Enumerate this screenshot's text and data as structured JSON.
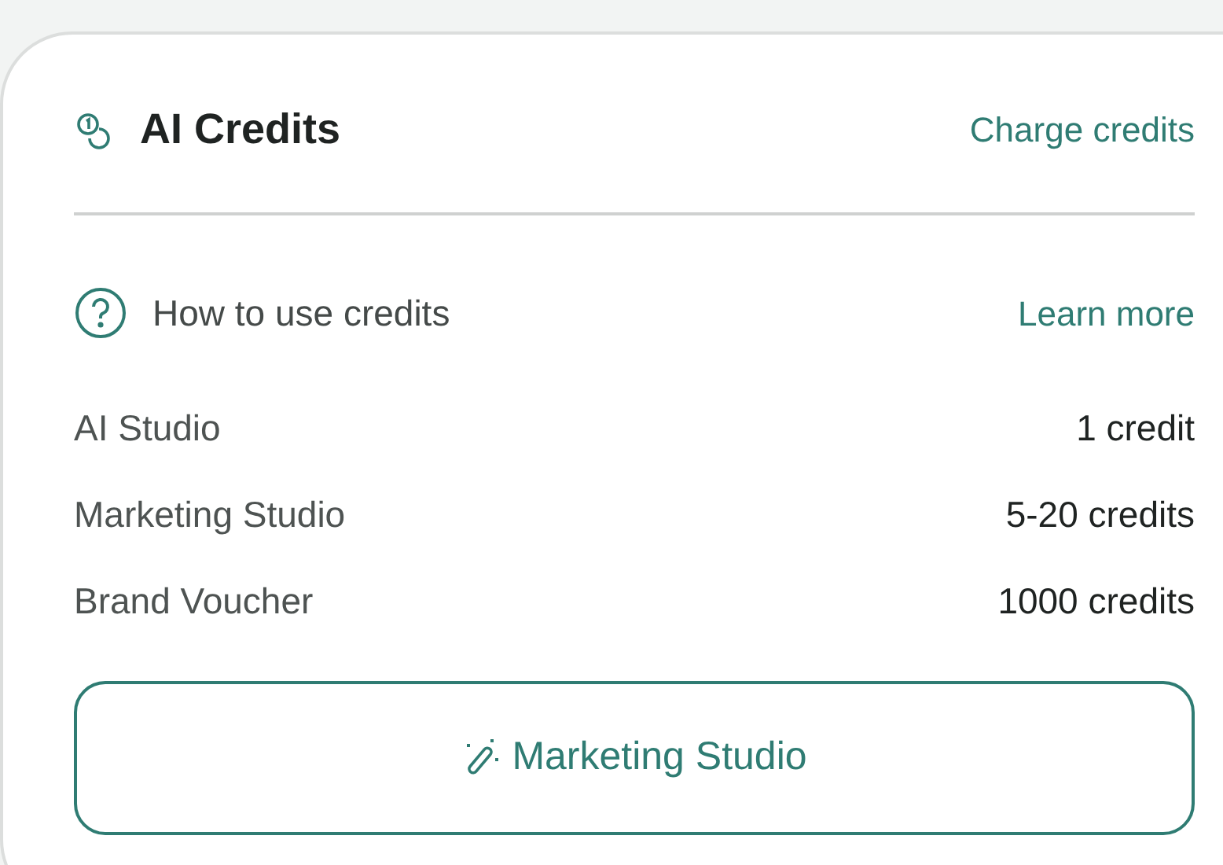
{
  "header": {
    "title": "AI Credits",
    "action": "Charge credits"
  },
  "help": {
    "label": "How to use credits",
    "link": "Learn more"
  },
  "costs": [
    {
      "name": "AI Studio",
      "value": "1 credit"
    },
    {
      "name": "Marketing Studio",
      "value": "5-20 credits"
    },
    {
      "name": "Brand Voucher",
      "value": "1000 credits"
    }
  ],
  "button": {
    "label": "Marketing Studio"
  }
}
